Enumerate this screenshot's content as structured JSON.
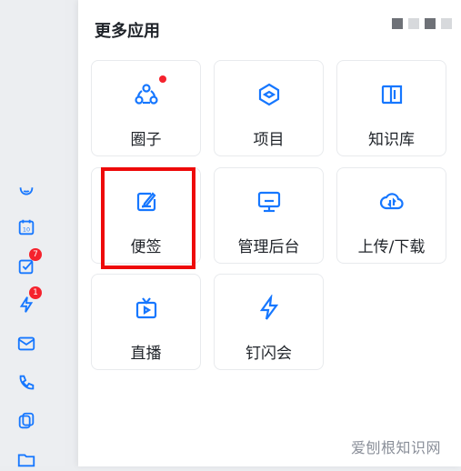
{
  "panel": {
    "title": "更多应用",
    "apps": [
      {
        "label": "圈子",
        "icon": "circle-group-icon",
        "has_dot": true
      },
      {
        "label": "项目",
        "icon": "project-cube-icon",
        "has_dot": false
      },
      {
        "label": "知识库",
        "icon": "book-icon",
        "has_dot": false
      },
      {
        "label": "便签",
        "icon": "note-edit-icon",
        "has_dot": false
      },
      {
        "label": "管理后台",
        "icon": "monitor-icon",
        "has_dot": false
      },
      {
        "label": "上传/下载",
        "icon": "cloud-transfer-icon",
        "has_dot": false
      },
      {
        "label": "直播",
        "icon": "tv-live-icon",
        "has_dot": false
      },
      {
        "label": "钉闪会",
        "icon": "lightning-icon",
        "has_dot": false
      }
    ]
  },
  "sidebar": {
    "items": [
      {
        "icon": "cloud-icon",
        "badge": ""
      },
      {
        "icon": "calendar-icon",
        "badge": ""
      },
      {
        "icon": "todo-check-icon",
        "badge": "7"
      },
      {
        "icon": "ding-lightning-icon",
        "badge": "1"
      },
      {
        "icon": "mail-icon",
        "badge": ""
      },
      {
        "icon": "phone-call-icon",
        "badge": ""
      },
      {
        "icon": "docs-icon",
        "badge": ""
      },
      {
        "icon": "folder-icon",
        "badge": ""
      }
    ]
  },
  "watermark": "爱刨根知识网",
  "colors": {
    "accent": "#1677ff",
    "badge": "#f5222d",
    "highlight": "#ee0a0a"
  }
}
